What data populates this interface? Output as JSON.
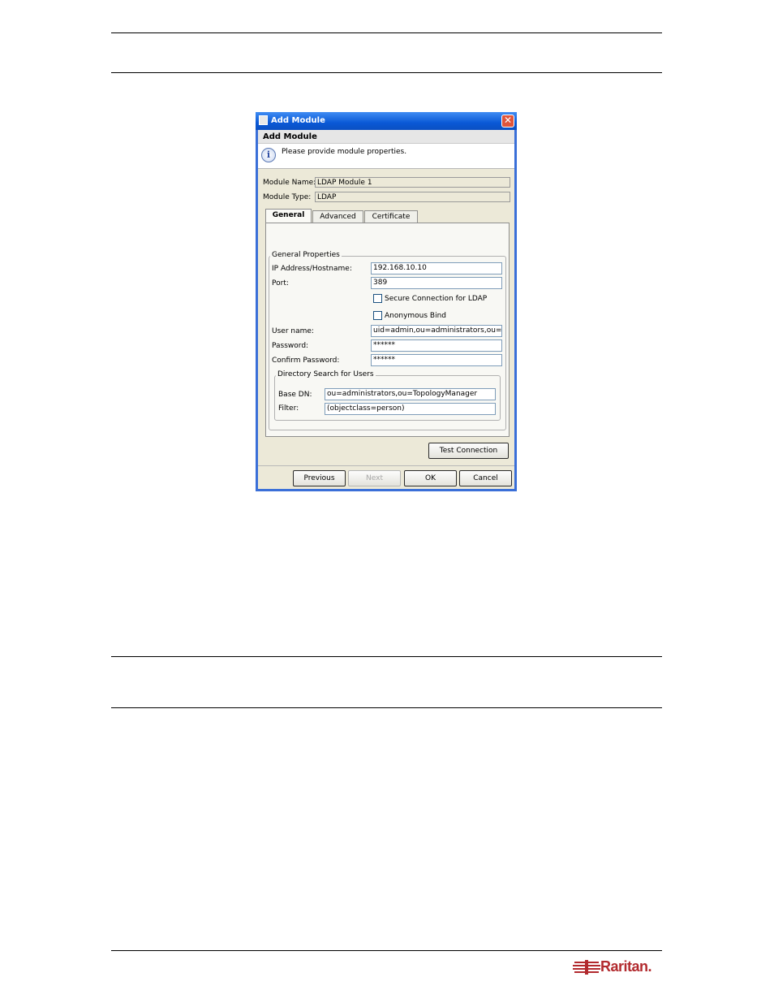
{
  "dialog": {
    "window_title": "Add Module",
    "header_title": "Add Module",
    "info_text": "Please provide module properties.",
    "module_name_label": "Module Name:",
    "module_name_value": "LDAP Module 1",
    "module_type_label": "Module Type:",
    "module_type_value": "LDAP",
    "tabs": [
      {
        "label": "General",
        "active": true
      },
      {
        "label": "Advanced",
        "active": false
      },
      {
        "label": "Certificate",
        "active": false
      }
    ],
    "general": {
      "legend": "General Properties",
      "ip_label": "IP Address/Hostname:",
      "ip_value": "192.168.10.10",
      "port_label": "Port:",
      "port_value": "389",
      "secure_label": "Secure Connection for LDAP",
      "secure_checked": false,
      "anon_label": "Anonymous Bind",
      "anon_checked": false,
      "user_label": "User name:",
      "user_value": "uid=admin,ou=administrators,ou=T",
      "password_label": "Password:",
      "password_value": "******",
      "confirm_label": "Confirm Password:",
      "confirm_value": "******"
    },
    "directory": {
      "legend": "Directory Search for Users",
      "base_dn_label": "Base DN:",
      "base_dn_value": "ou=administrators,ou=TopologyManager",
      "filter_label": "Filter:",
      "filter_value": "(objectclass=person)"
    },
    "test_connection": "Test Connection",
    "buttons": {
      "previous": "Previous",
      "next": "Next",
      "ok": "OK",
      "cancel": "Cancel"
    }
  },
  "footer": {
    "brand": "Raritan.",
    "brand_color": "#b22a2e"
  }
}
